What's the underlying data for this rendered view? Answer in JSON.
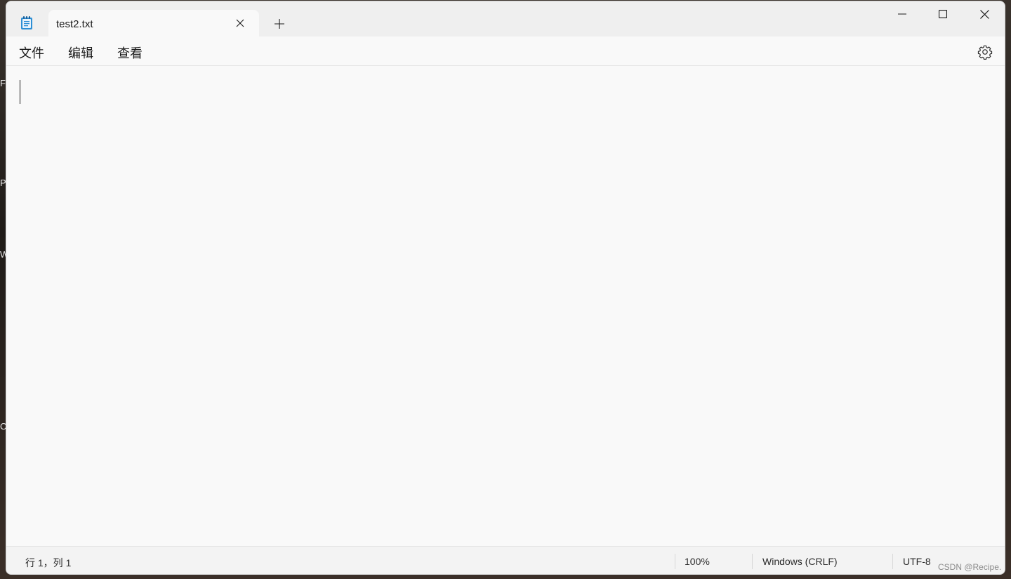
{
  "desktop": {
    "fragments": [
      "F",
      "P",
      "W",
      "C"
    ]
  },
  "titlebar": {
    "tab_label": "test2.txt",
    "icons": {
      "app": "notepad-icon",
      "tab_close": "close-icon",
      "new_tab": "plus-icon",
      "minimize": "minimize-icon",
      "maximize": "maximize-icon",
      "close": "close-icon"
    }
  },
  "menubar": {
    "items": [
      {
        "label": "文件"
      },
      {
        "label": "编辑"
      },
      {
        "label": "查看"
      }
    ],
    "settings_icon": "gear-icon"
  },
  "editor": {
    "content": ""
  },
  "statusbar": {
    "position": "行 1，列 1",
    "zoom": "100%",
    "line_ending": "Windows (CRLF)",
    "encoding": "UTF-8"
  },
  "watermark": "CSDN @Recipe.",
  "colors": {
    "background": "#f9f9f9",
    "titlebar": "#efefef",
    "statusbar": "#f3f3f3",
    "icon_blue": "#2d8fd5"
  }
}
